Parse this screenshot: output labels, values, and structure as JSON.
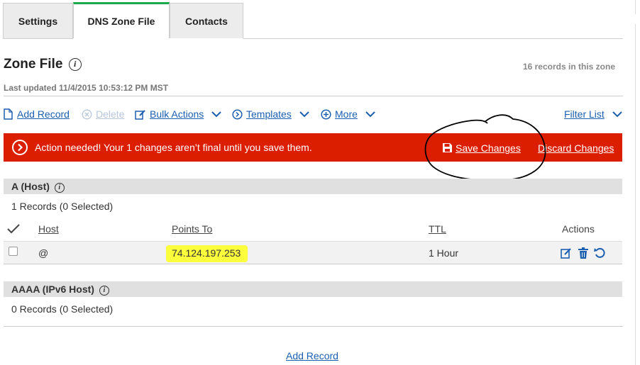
{
  "tabs": [
    {
      "label": "Settings",
      "active": false
    },
    {
      "label": "DNS Zone File",
      "active": true
    },
    {
      "label": "Contacts",
      "active": false
    }
  ],
  "header": {
    "title": "Zone File",
    "records_count": "16 records in this zone",
    "last_updated": "Last updated 11/4/2015 10:53:12 PM MST"
  },
  "toolbar": {
    "add_record": "Add Record",
    "delete": "Delete",
    "bulk_actions": "Bulk Actions",
    "templates": "Templates",
    "more": "More",
    "filter_list": "Filter List"
  },
  "banner": {
    "message": "Action needed! Your 1 changes aren’t final until you save them.",
    "save_changes": "Save Changes",
    "discard_changes": "Discard Changes",
    "color": "#dc1e00"
  },
  "sections": [
    {
      "title": "A (Host)",
      "records_text": "1 Records (0 Selected)",
      "columns": {
        "host": "Host",
        "points_to": "Points To",
        "ttl": "TTL",
        "actions": "Actions"
      },
      "rows": [
        {
          "host": "@",
          "points_to": "74.124.197.253",
          "ttl": "1 Hour"
        }
      ]
    },
    {
      "title": "AAAA (IPv6 Host)",
      "records_text": "0 Records (0 Selected)"
    }
  ],
  "footer": {
    "add_record": "Add Record"
  },
  "colors": {
    "accent": "#1ba84e",
    "link": "#1b5fb0",
    "highlight": "#fbff3c"
  }
}
